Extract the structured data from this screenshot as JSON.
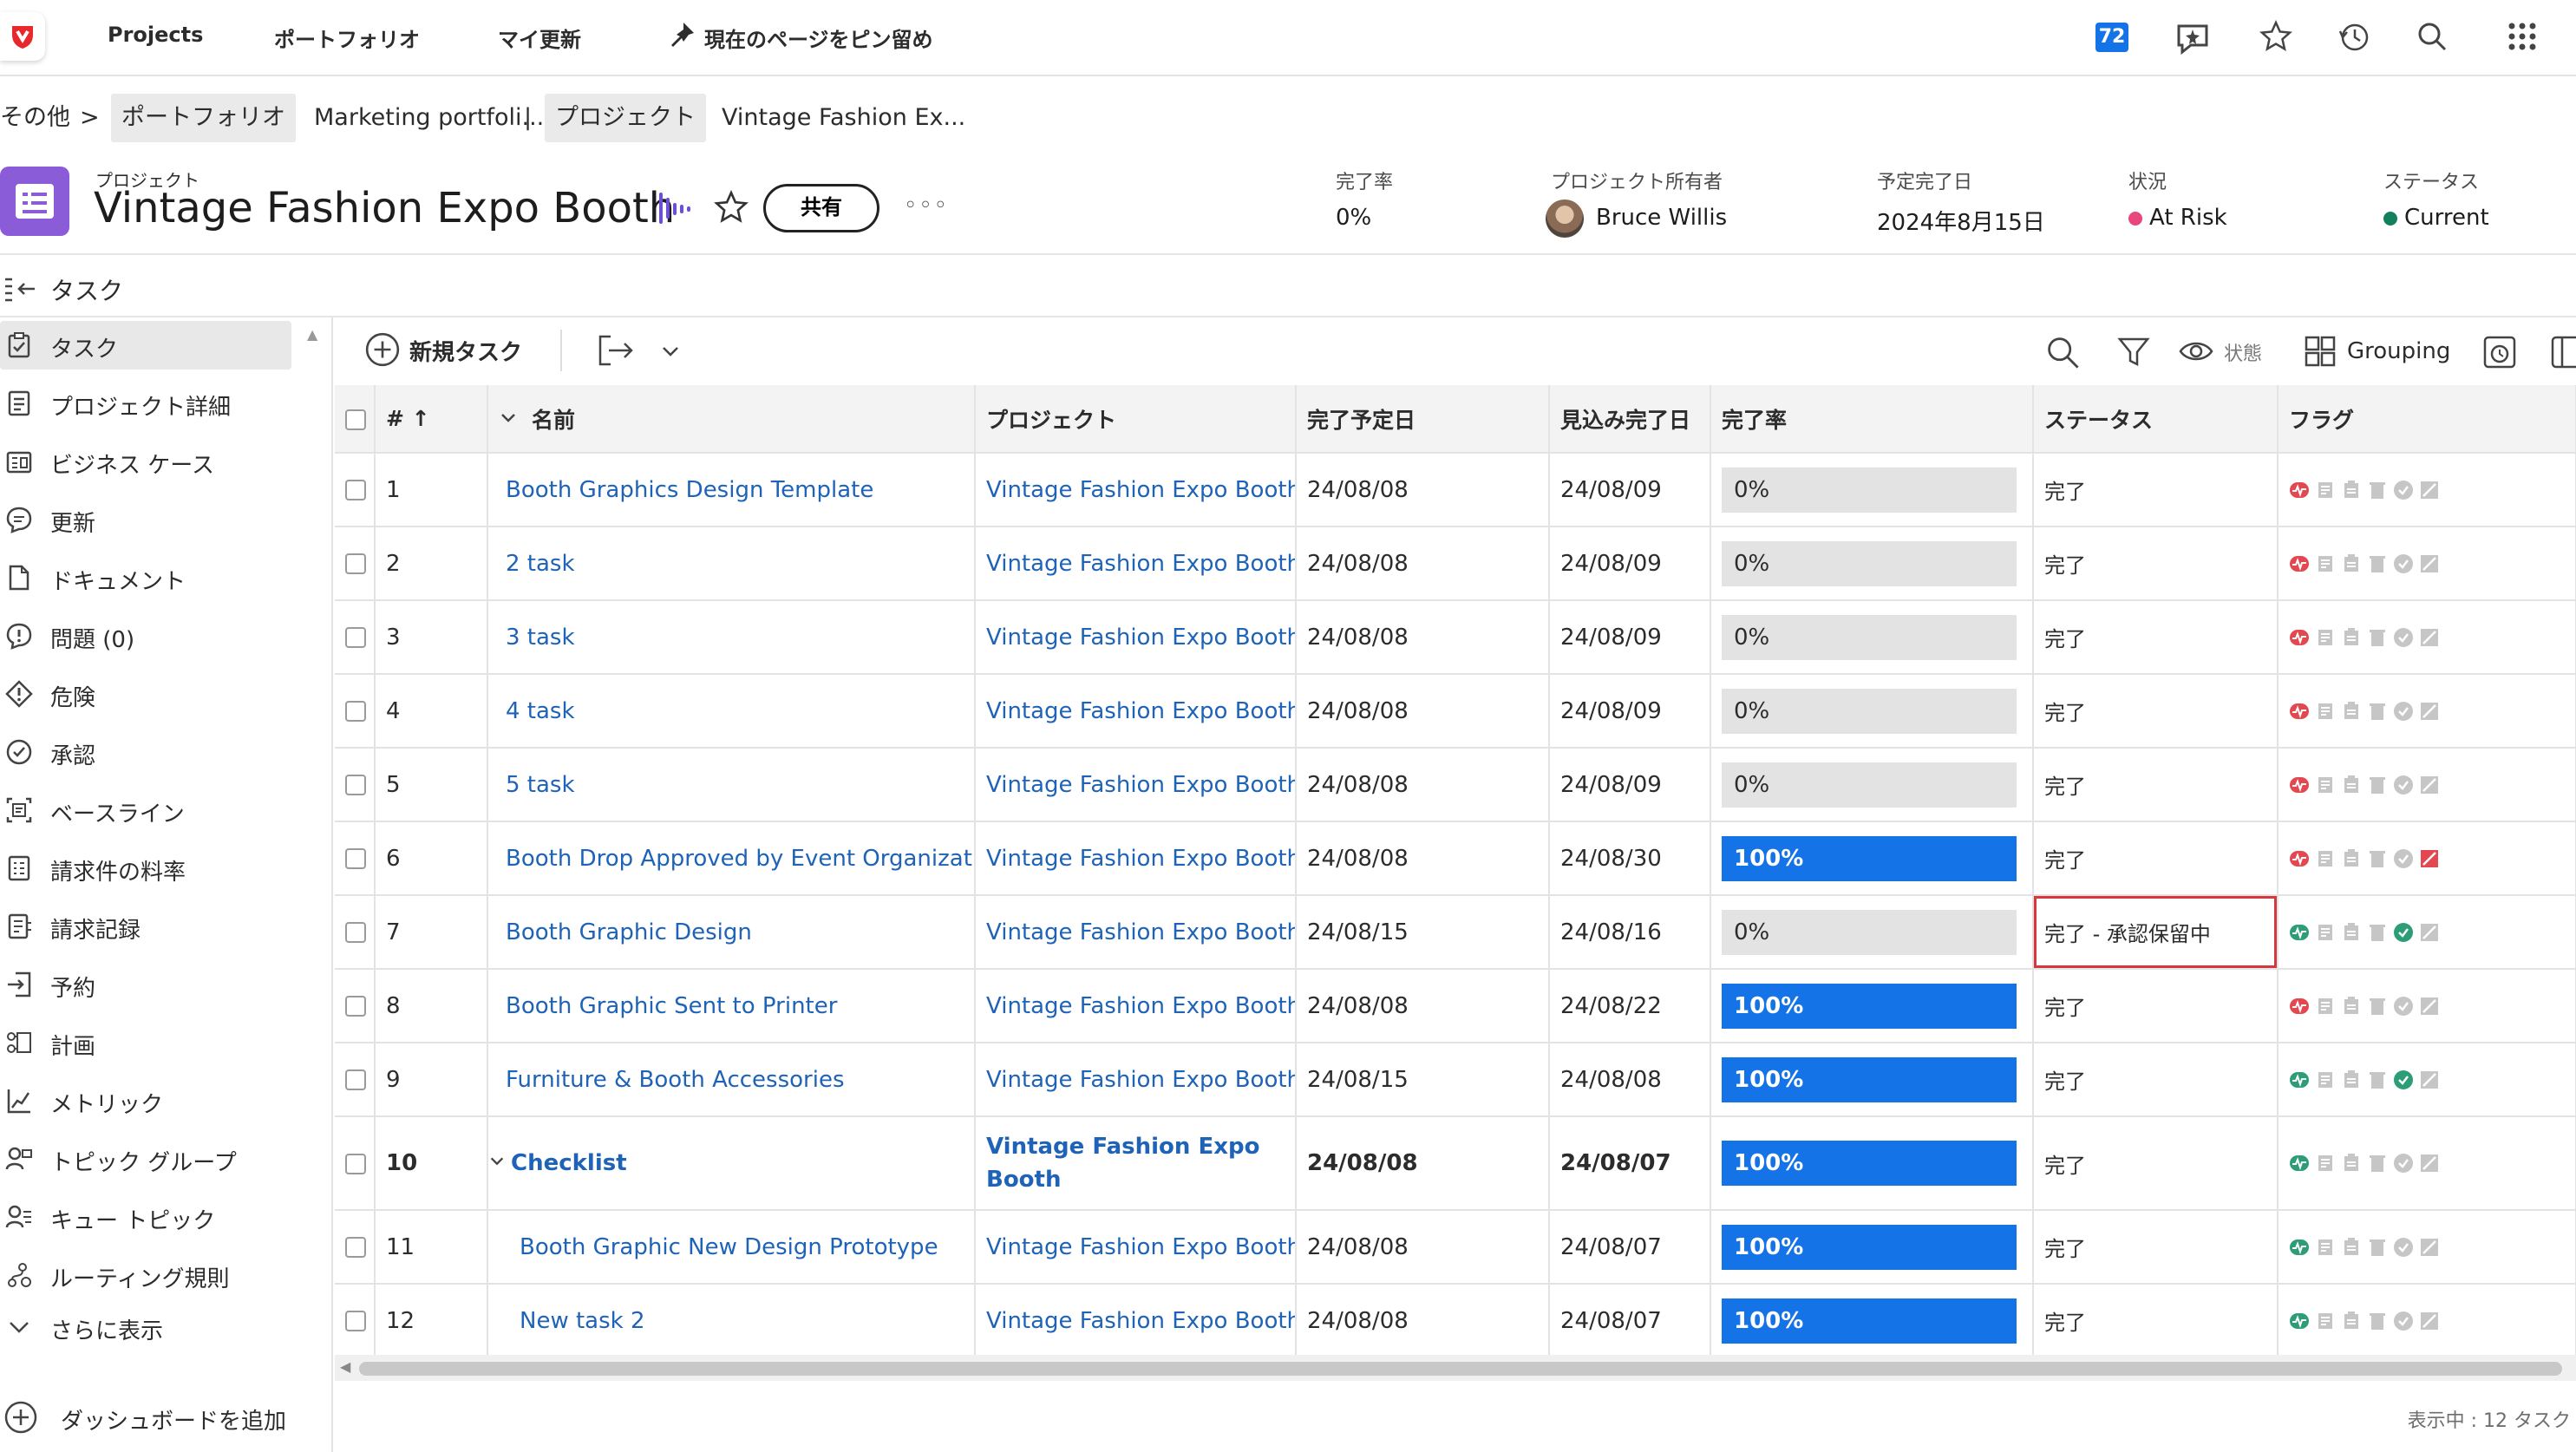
{
  "topnav": {
    "projects": "Projects",
    "portfolio": "ポートフォリオ",
    "my_updates": "マイ更新",
    "pin_page": "現在のページをピン留め",
    "notification_count": "72"
  },
  "breadcrumb": {
    "other": "その他",
    "sep": ">",
    "portfolio": "ポートフォリオ",
    "portfolio_name": "Marketing portfoli...",
    "bar": "|",
    "project": "プロジェクト",
    "project_name": "Vintage Fashion Ex..."
  },
  "project": {
    "kicker": "プロジェクト",
    "title": "Vintage Fashion Expo Booth",
    "share": "共有",
    "more": "◦◦◦",
    "meta": {
      "completion_label": "完了率",
      "completion_value": "0%",
      "owner_label": "プロジェクト所有者",
      "owner_value": "Bruce Willis",
      "planned_label": "予定完了日",
      "planned_value": "2024年8月15日",
      "condition_label": "状況",
      "condition_value": "At Risk",
      "status_label": "ステータス",
      "status_value": "Current"
    },
    "colors": {
      "at_risk": "#e8467c",
      "current": "#12805c",
      "accent": "#8a5cd8"
    }
  },
  "sidebar": {
    "header": "タスク",
    "items": [
      {
        "label": "タスク",
        "icon": "task-icon"
      },
      {
        "label": "プロジェクト詳細",
        "icon": "details-icon"
      },
      {
        "label": "ビジネス ケース",
        "icon": "business-case-icon"
      },
      {
        "label": "更新",
        "icon": "updates-icon"
      },
      {
        "label": "ドキュメント",
        "icon": "document-icon"
      },
      {
        "label": "問題 (0)",
        "icon": "issues-icon"
      },
      {
        "label": "危険",
        "icon": "risk-icon"
      },
      {
        "label": "承認",
        "icon": "approval-icon"
      },
      {
        "label": "ベースライン",
        "icon": "baseline-icon"
      },
      {
        "label": "請求件の料率",
        "icon": "billing-rate-icon"
      },
      {
        "label": "請求記録",
        "icon": "billing-record-icon"
      },
      {
        "label": "予約",
        "icon": "booking-icon"
      },
      {
        "label": "計画",
        "icon": "plan-icon"
      },
      {
        "label": "メトリック",
        "icon": "metric-icon"
      },
      {
        "label": "トピック グループ",
        "icon": "topic-group-icon"
      },
      {
        "label": "キュー トピック",
        "icon": "queue-topic-icon"
      },
      {
        "label": "ルーティング規則",
        "icon": "routing-icon"
      },
      {
        "label": "さらに表示",
        "icon": "chevron-down-icon"
      }
    ],
    "add_dashboard": "ダッシュボードを追加"
  },
  "toolbar": {
    "new_task": "新規タスク",
    "status": "状態",
    "grouping": "Grouping"
  },
  "table": {
    "headers": {
      "num": "# ↑",
      "name": "名前",
      "project": "プロジェクト",
      "planned": "完了予定日",
      "projected": "見込み完了日",
      "percent": "完了率",
      "status": "ステータス",
      "flags": "フラグ"
    },
    "rows": [
      {
        "num": "1",
        "name": "Booth Graphics Design Template",
        "project": "Vintage Fashion Expo Booth",
        "planned": "24/08/08",
        "projected": "24/08/09",
        "percent": "0%",
        "status": "完了"
      },
      {
        "num": "2",
        "name": "2 task",
        "project": "Vintage Fashion Expo Booth",
        "planned": "24/08/08",
        "projected": "24/08/09",
        "percent": "0%",
        "status": "完了"
      },
      {
        "num": "3",
        "name": "3 task",
        "project": "Vintage Fashion Expo Booth",
        "planned": "24/08/08",
        "projected": "24/08/09",
        "percent": "0%",
        "status": "完了"
      },
      {
        "num": "4",
        "name": "4 task",
        "project": "Vintage Fashion Expo Booth",
        "planned": "24/08/08",
        "projected": "24/08/09",
        "percent": "0%",
        "status": "完了"
      },
      {
        "num": "5",
        "name": "5 task",
        "project": "Vintage Fashion Expo Booth",
        "planned": "24/08/08",
        "projected": "24/08/09",
        "percent": "0%",
        "status": "完了"
      },
      {
        "num": "6",
        "name": "Booth Drop Approved by Event Organization",
        "project": "Vintage Fashion Expo Booth",
        "planned": "24/08/08",
        "projected": "24/08/30",
        "percent": "100%",
        "status": "完了"
      },
      {
        "num": "7",
        "name": "Booth Graphic Design",
        "project": "Vintage Fashion Expo Booth",
        "planned": "24/08/15",
        "projected": "24/08/16",
        "percent": "0%",
        "status": "完了 - 承認保留中"
      },
      {
        "num": "8",
        "name": "Booth Graphic Sent to Printer",
        "project": "Vintage Fashion Expo Booth",
        "planned": "24/08/08",
        "projected": "24/08/22",
        "percent": "100%",
        "status": "完了"
      },
      {
        "num": "9",
        "name": "Furniture & Booth Accessories",
        "project": "Vintage Fashion Expo Booth",
        "planned": "24/08/15",
        "projected": "24/08/08",
        "percent": "100%",
        "status": "完了"
      },
      {
        "num": "10",
        "name": "Checklist",
        "project": "Vintage Fashion Expo Booth",
        "planned": "24/08/08",
        "projected": "24/08/07",
        "percent": "100%",
        "status": "完了"
      },
      {
        "num": "11",
        "name": "Booth Graphic New Design Prototype",
        "project": "Vintage Fashion Expo Booth",
        "planned": "24/08/08",
        "projected": "24/08/07",
        "percent": "100%",
        "status": "完了"
      },
      {
        "num": "12",
        "name": "New task 2",
        "project": "Vintage Fashion Expo Booth",
        "planned": "24/08/08",
        "projected": "24/08/07",
        "percent": "100%",
        "status": "完了"
      }
    ],
    "flag_colors": {
      "red": "#e34850",
      "green": "#2d9d78",
      "grey": "#c6c6c6",
      "progress": "#1473e6"
    }
  },
  "footer": {
    "count": "表示中 : 12 タスク"
  }
}
